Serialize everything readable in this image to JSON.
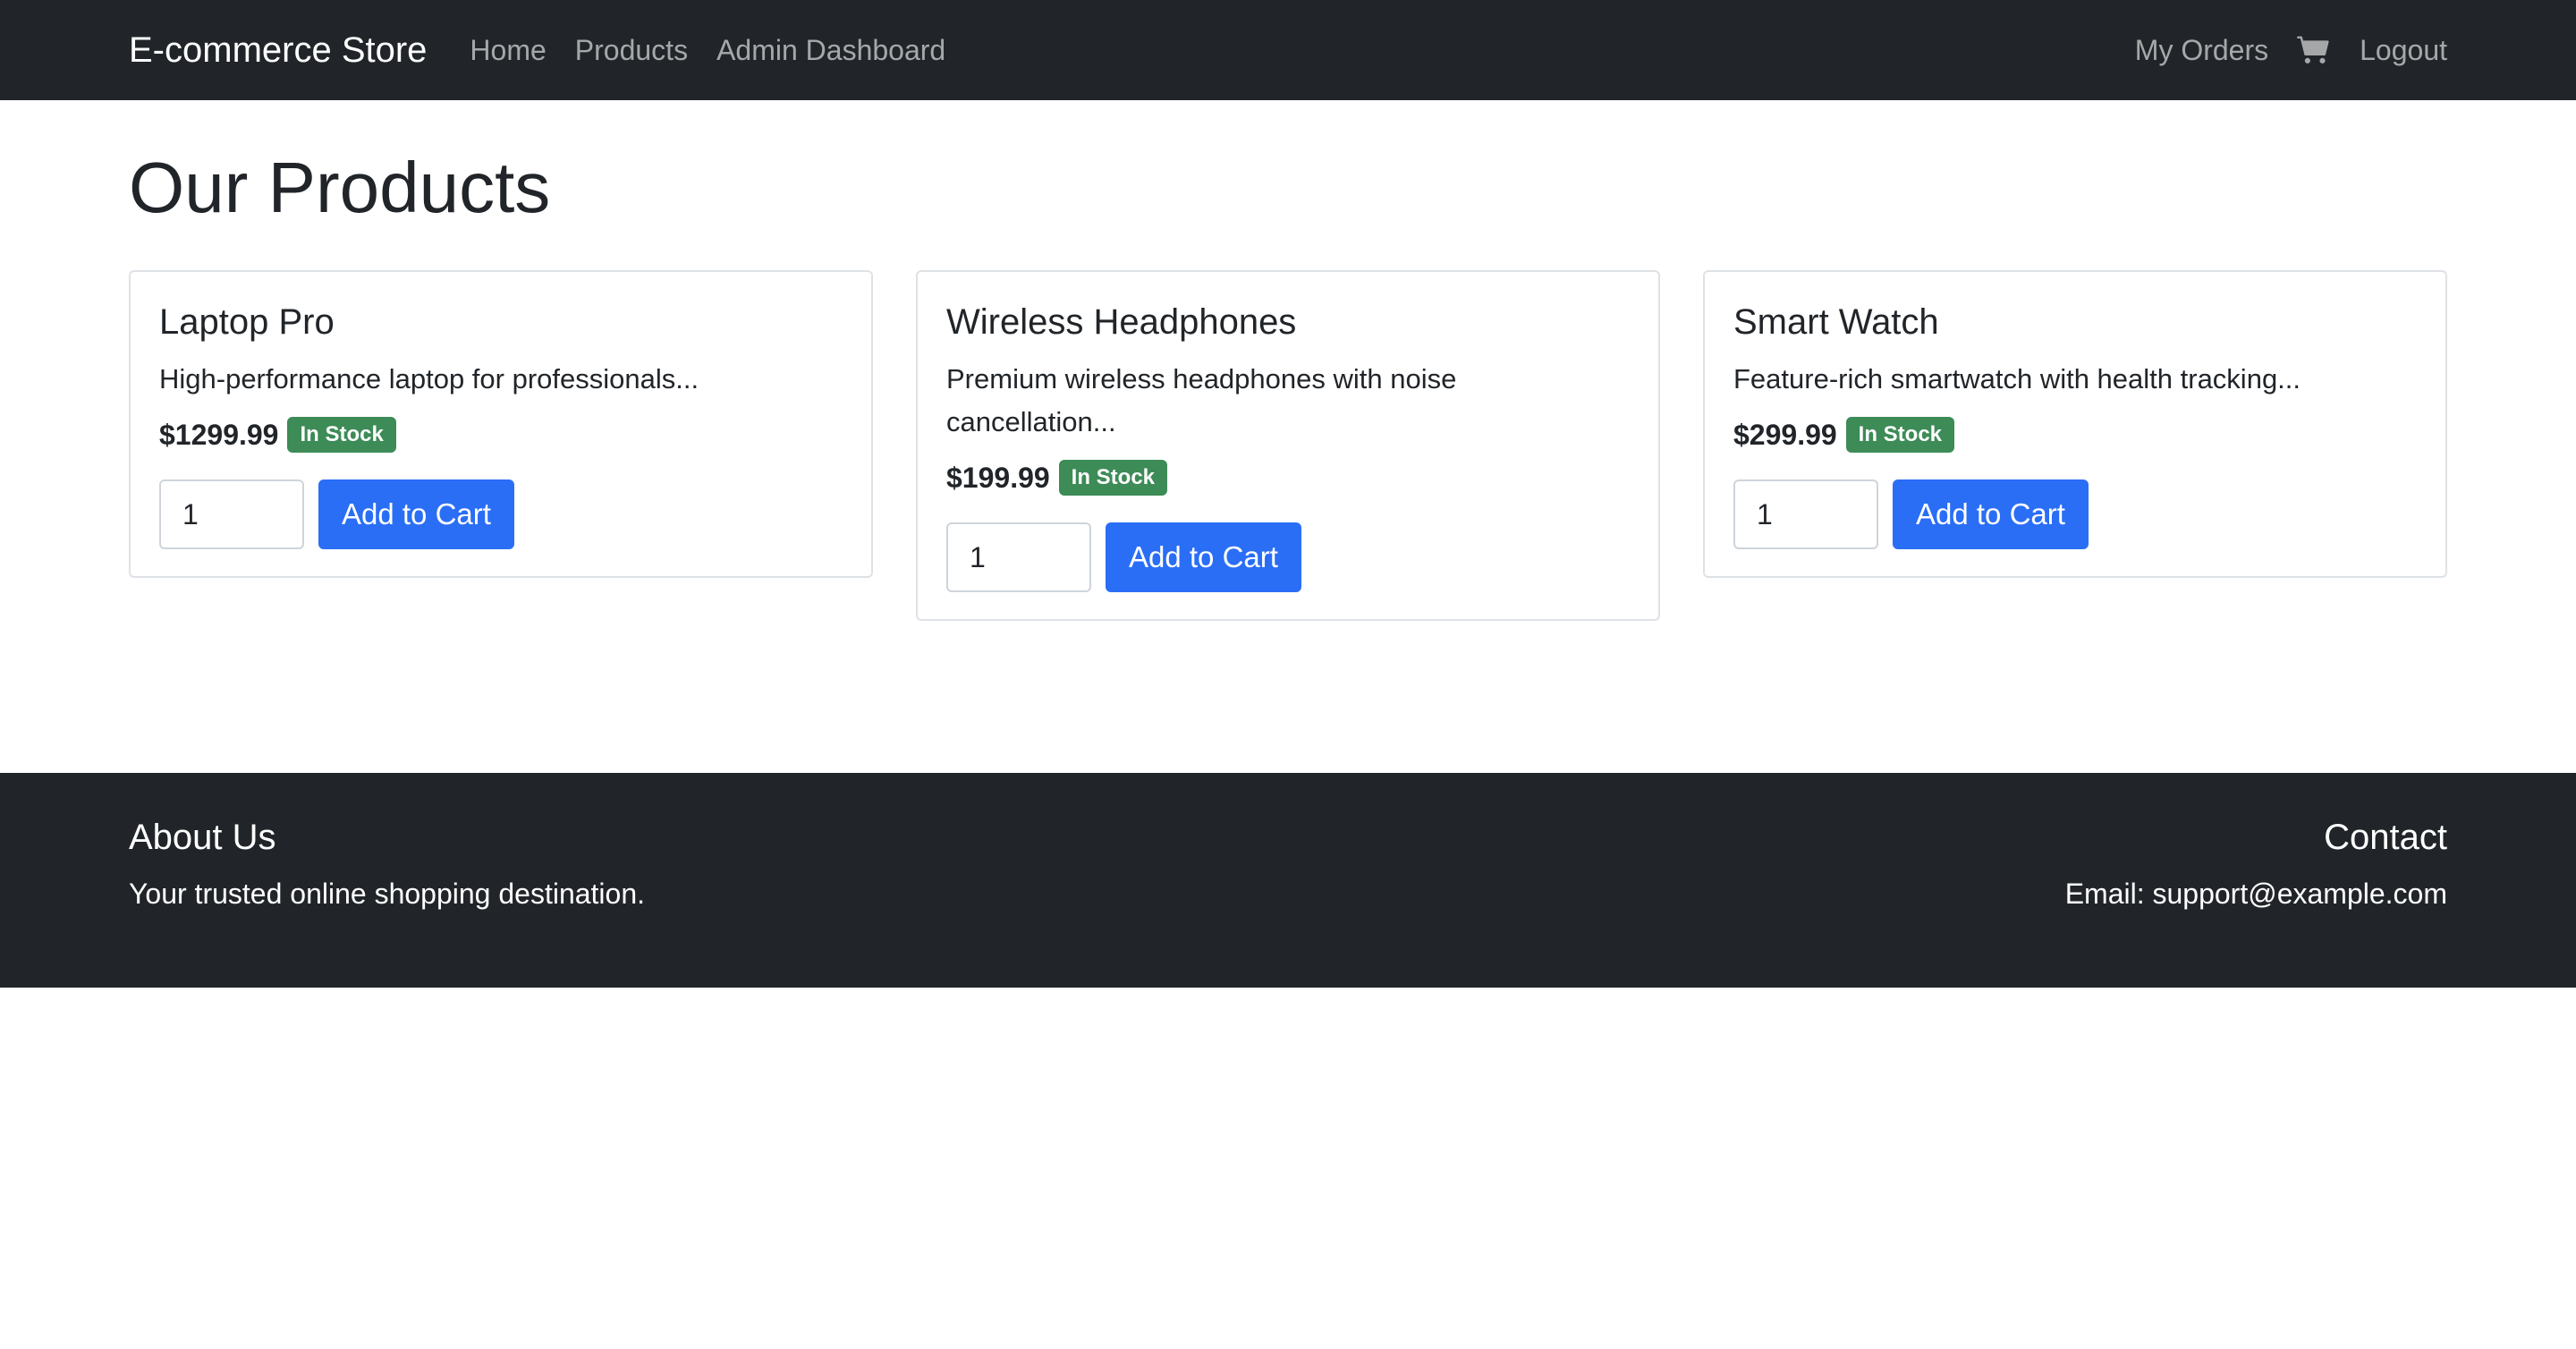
{
  "navbar": {
    "brand": "E-commerce Store",
    "links": [
      "Home",
      "Products",
      "Admin Dashboard"
    ],
    "my_orders": "My Orders",
    "cart_icon": "cart-icon",
    "logout": "Logout"
  },
  "main": {
    "title": "Our Products",
    "products": [
      {
        "name": "Laptop Pro",
        "description": "High-performance laptop for professionals...",
        "price": "$1299.99",
        "stock": "In Stock",
        "quantity": "1",
        "button": "Add to Cart"
      },
      {
        "name": "Wireless Headphones",
        "description": "Premium wireless headphones with noise cancellation...",
        "price": "$199.99",
        "stock": "In Stock",
        "quantity": "1",
        "button": "Add to Cart"
      },
      {
        "name": "Smart Watch",
        "description": "Feature-rich smartwatch with health tracking...",
        "price": "$299.99",
        "stock": "In Stock",
        "quantity": "1",
        "button": "Add to Cart"
      }
    ]
  },
  "footer": {
    "about_title": "About Us",
    "about_text": "Your trusted online shopping destination.",
    "contact_title": "Contact",
    "contact_text": "Email: support@example.com"
  },
  "colors": {
    "navbar_bg": "#212529",
    "primary_button": "#2a6ef6",
    "stock_badge": "#3d8b57"
  }
}
